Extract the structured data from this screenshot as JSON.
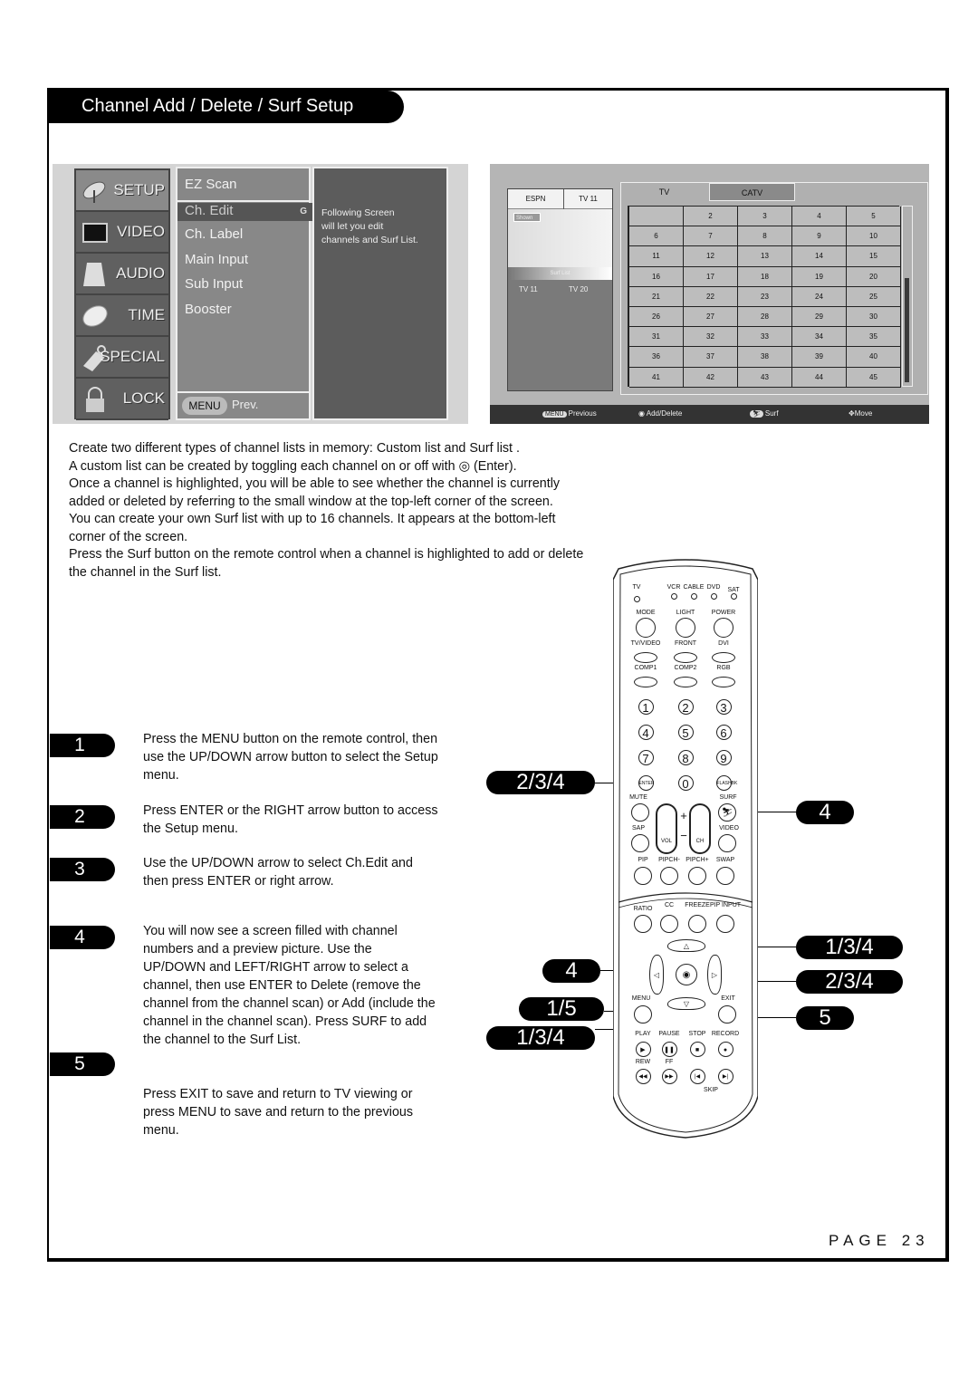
{
  "title": "Channel Add / Delete / Surf Setup",
  "setup_menu": {
    "categories": [
      {
        "label": "SETUP",
        "icon": "satellite-icon",
        "active": true
      },
      {
        "label": "VIDEO",
        "icon": "tv-icon",
        "active": false
      },
      {
        "label": "AUDIO",
        "icon": "speaker-icon",
        "active": false
      },
      {
        "label": "TIME",
        "icon": "clock-icon",
        "active": false
      },
      {
        "label": "SPECIAL",
        "icon": "tag-icon",
        "active": false
      },
      {
        "label": "LOCK",
        "icon": "padlock-icon",
        "active": false
      }
    ],
    "items": [
      "EZ Scan",
      "Ch. Edit",
      "Ch. Label",
      "Main Input",
      "Sub Input",
      "Booster"
    ],
    "selected_item": "Ch. Edit",
    "selected_marker": "G",
    "footer_button": "MENU",
    "footer_label": "Prev.",
    "description": [
      "Following Screen",
      "will let you edit",
      "channels and Surf List."
    ]
  },
  "channel_screen": {
    "preview_header": [
      "ESPN",
      "TV 11"
    ],
    "shown_label": "Shown",
    "surf_list_label": "Surf List",
    "surf_list": [
      "TV 11",
      "TV 20"
    ],
    "tabs": [
      "TV",
      "CATV"
    ],
    "active_tab": "CATV",
    "grid": [
      [
        "",
        "2",
        "3",
        "4",
        "5"
      ],
      [
        "6",
        "7",
        "8",
        "9",
        "10"
      ],
      [
        "11",
        "12",
        "13",
        "14",
        "15"
      ],
      [
        "16",
        "17",
        "18",
        "19",
        "20"
      ],
      [
        "21",
        "22",
        "23",
        "24",
        "25"
      ],
      [
        "26",
        "27",
        "28",
        "29",
        "30"
      ],
      [
        "31",
        "32",
        "33",
        "34",
        "35"
      ],
      [
        "36",
        "37",
        "38",
        "39",
        "40"
      ],
      [
        "41",
        "42",
        "43",
        "44",
        "45"
      ]
    ],
    "scroll_position": 0.4,
    "footer": [
      {
        "key": "MENU",
        "label": "Previous"
      },
      {
        "key": "enter-icon",
        "label": "Add/Delete"
      },
      {
        "key": "surf-icon",
        "label": "Surf"
      },
      {
        "key": "move-arrows-icon",
        "label": "Move"
      }
    ]
  },
  "intro": [
    "Create two different types of channel lists in memory:  Custom list  and  Surf list .",
    "A custom list can be created by toggling each channel on or off with  ◎ (Enter).",
    "Once a channel is highlighted, you will be able to see whether the channel is currently added or deleted by referring to the small window at the top-left corner of the screen.",
    "You can create your own Surf list with up to 16 channels. It appears at the bottom-left corner of the screen.",
    "Press the Surf button on the remote control when a channel is highlighted to add or delete the channel in the Surf list."
  ],
  "steps": [
    {
      "num": "1",
      "text": "Press the MENU button on the remote control, then use the UP/DOWN arrow button to select the Setup menu."
    },
    {
      "num": "2",
      "text": "Press ENTER or the RIGHT arrow button to access the Setup menu."
    },
    {
      "num": "3",
      "text": "Use the UP/DOWN arrow to select Ch.Edit and then press ENTER or right arrow."
    },
    {
      "num": "4",
      "text": "You will now see a screen filled with channel numbers and a preview picture. Use the UP/DOWN and LEFT/RIGHT arrow to select a channel, then use ENTER to Delete (remove the channel from the channel scan) or Add (include the channel in the channel scan). Press SURF to add the channel to the Surf List."
    },
    {
      "num": "5",
      "text": ""
    }
  ],
  "exit_note": "Press EXIT to save and return to TV viewing or press MENU to save and return to the previous menu.",
  "callouts": {
    "enter": "2/3/4",
    "surf": "4",
    "up": "1/3/4",
    "right": "2/3/4",
    "exit": "5",
    "left": "4",
    "menu": "1/5",
    "down": "1/3/4"
  },
  "remote": {
    "source_labels": [
      "TV",
      "VCR",
      "CABLE",
      "DVD",
      "SAT"
    ],
    "row1": [
      "MODE",
      "LIGHT",
      "POWER"
    ],
    "row2": [
      "TV/VIDEO",
      "FRONT",
      "DVI"
    ],
    "row3": [
      "COMP1",
      "COMP2",
      "RGB"
    ],
    "digits": [
      "1",
      "2",
      "3",
      "4",
      "5",
      "6",
      "7",
      "8",
      "9",
      "ENTER",
      "0",
      "FLASHBK"
    ],
    "mute": "MUTE",
    "surf": "SURF",
    "sap": "SAP",
    "video": "VIDEO",
    "vol": "VOL",
    "ch": "CH",
    "plus": "+",
    "minus": "−",
    "pip_row": [
      "PIP",
      "PIPCH-",
      "PIPCH+",
      "SWAP"
    ],
    "ratio_row": [
      "RATIO",
      "CC",
      "FREEZE",
      "PIP INPUT"
    ],
    "menu": "MENU",
    "exit": "EXIT",
    "transport": [
      "PLAY",
      "PAUSE",
      "STOP",
      "RECORD"
    ],
    "transport2": [
      "REW",
      "FF"
    ],
    "skip": "SKIP"
  },
  "page_label": "PAGE 23"
}
